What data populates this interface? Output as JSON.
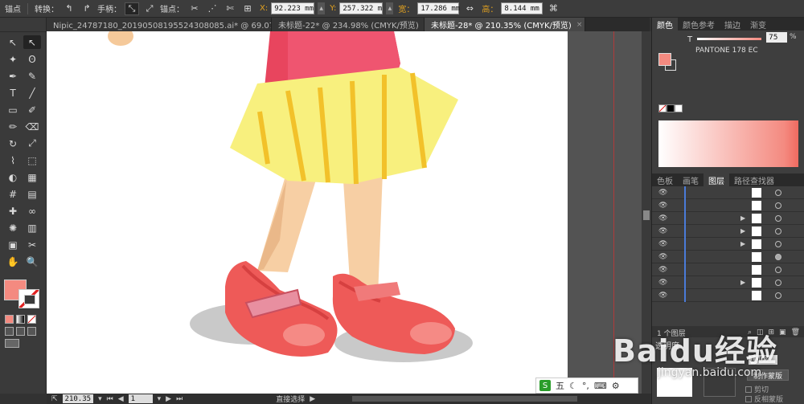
{
  "control_bar": {
    "anchor_label": "锚点",
    "convert_label": "转换：",
    "handles_label": "手柄：",
    "anchors_label": "锚点：",
    "x_label": "X:",
    "x_value": "92.223 mm",
    "y_label": "Y:",
    "y_value": "257.322 m",
    "w_label": "宽：",
    "w_value": "17.286 mm",
    "h_label": "高：",
    "h_value": "8.144 mm"
  },
  "doc_tabs": [
    {
      "label": "Nipic_24787180_20190508195524308085.ai* @ 69.07% (RGB/预...",
      "active": false
    },
    {
      "label": "未标题-22* @ 234.98% (CMYK/预览)",
      "active": false
    },
    {
      "label": "未标题-28* @ 210.35% (CMYK/预览)",
      "active": true
    }
  ],
  "tab_close": "×",
  "tools_icons": [
    "selection-icon",
    "direct-selection-icon",
    "magic-wand-icon",
    "lasso-icon",
    "pen-icon",
    "curvature-icon",
    "type-icon",
    "line-icon",
    "rectangle-icon",
    "paintbrush-icon",
    "pencil-icon",
    "eraser-icon",
    "rotate-icon",
    "scale-icon",
    "warp-icon",
    "free-transform-icon",
    "shape-builder-icon",
    "perspective-icon",
    "mesh-icon",
    "gradient-icon",
    "eyedropper-icon",
    "blend-icon",
    "symbol-sprayer-icon",
    "column-graph-icon",
    "artboard-icon",
    "slice-icon",
    "hand-icon",
    "zoom-icon"
  ],
  "tools_glyphs": [
    "↖",
    "↖",
    "✦",
    "ʘ",
    "✒",
    "✎",
    "T",
    "╱",
    "▭",
    "✐",
    "✏",
    "⌫",
    "↻",
    "⤢",
    "⌇",
    "⬚",
    "◐",
    "▦",
    "#",
    "▤",
    "✚",
    "∞",
    "✺",
    "▥",
    "▣",
    "✂",
    "✋",
    "🔍"
  ],
  "fill_color": "#f48a80",
  "status": {
    "zoom": "210.35",
    "page": "1",
    "tool": "直接选择"
  },
  "color_panel": {
    "tabs": [
      "颜色",
      "颜色参考",
      "描边",
      "渐变"
    ],
    "t_label": "T",
    "tint_value": "75",
    "pct_sign": "%",
    "pantone": "PANTONE 178 EC"
  },
  "layers_panel": {
    "tabs": [
      "色板",
      "画笔",
      "图层",
      "路径查找器"
    ],
    "rows": [
      {
        "arrow": false,
        "circle_filled": false
      },
      {
        "arrow": false,
        "circle_filled": false
      },
      {
        "arrow": true,
        "circle_filled": false
      },
      {
        "arrow": true,
        "circle_filled": false
      },
      {
        "arrow": true,
        "circle_filled": false
      },
      {
        "arrow": false,
        "circle_filled": true
      },
      {
        "arrow": false,
        "circle_filled": false
      },
      {
        "arrow": true,
        "circle_filled": false
      },
      {
        "arrow": false,
        "circle_filled": false
      }
    ],
    "footer": "1 个图层"
  },
  "transparency_panel": {
    "title": "透明度",
    "opacity": "100%",
    "clip_button": "制作蒙版",
    "opt_clip": "剪切",
    "opt_invert": "反相蒙版"
  },
  "ime": {
    "badge": "S",
    "mode": "五"
  },
  "watermark": {
    "logo": "Baidu经验",
    "site": "jingyan.baidu.com"
  }
}
